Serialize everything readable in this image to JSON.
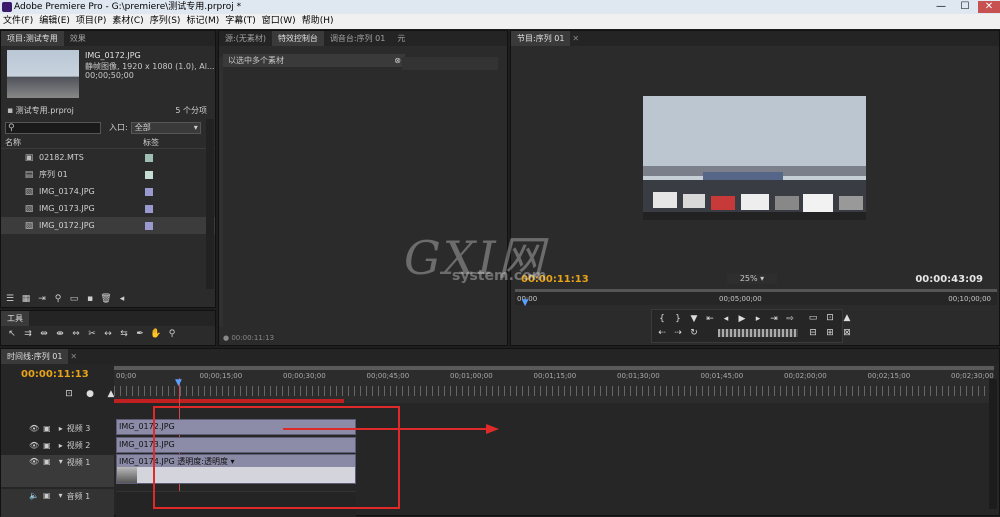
{
  "window": {
    "title": "Adobe Premiere Pro - G:\\premiere\\测试专用.prproj *",
    "minimize": "—",
    "maximize": "☐",
    "close": "✕"
  },
  "menu": [
    "文件(F)",
    "编辑(E)",
    "项目(P)",
    "素材(C)",
    "序列(S)",
    "标记(M)",
    "字幕(T)",
    "窗口(W)",
    "帮助(H)"
  ],
  "project": {
    "tabs": [
      "项目:测试专用",
      "效果"
    ],
    "preview": {
      "name": "IMG_0172.JPG",
      "info1": "静帧图像, 1920 x 1080 (1.0), Al...",
      "info2": "00;00;50;00"
    },
    "file": "测试专用.prproj",
    "count": "5 个分项",
    "entry_label": "入口:",
    "entry_value": "全部",
    "col_name": "名称",
    "col_label": "标签",
    "items": [
      {
        "name": "02182.MTS",
        "color": "#9fbeb4"
      },
      {
        "name": "序列 01",
        "color": "#c8dcd4"
      },
      {
        "name": "IMG_0174.JPG",
        "color": "#9a9ad0"
      },
      {
        "name": "IMG_0173.JPG",
        "color": "#9a9ad0"
      },
      {
        "name": "IMG_0172.JPG",
        "color": "#9a9ad0"
      }
    ]
  },
  "tools_tab": "工具",
  "effect_panel": {
    "tabs": [
      "源:(无素材)",
      "特效控制台",
      "调音台:序列 01",
      "元"
    ],
    "message": "以选中多个素材",
    "timecode": "00:00:11:13"
  },
  "program": {
    "tab": "节目:序列 01",
    "current_tc": "00:00:11:13",
    "zoom": "25%",
    "duration": "00:00:43:09",
    "ruler": [
      "00;00",
      "00;05;00;00",
      "00;10;00;00"
    ],
    "playhead_fraction": 0.018
  },
  "watermark": {
    "big": "GXI网",
    "small": "system.com"
  },
  "timeline": {
    "tab": "时间线:序列 01",
    "timecode": "00:00:11:13",
    "ruler": [
      "00;00",
      "00;00;15;00",
      "00;00;30;00",
      "00;00;45;00",
      "00;01;00;00",
      "00;01;15;00",
      "00;01;30;00",
      "00;01;45;00",
      "00;02;00;00",
      "00;02;15;00",
      "00;02;30;00"
    ],
    "tracks": [
      {
        "name": "视频 3",
        "clip": "IMG_0172.JPG"
      },
      {
        "name": "视频 2",
        "clip": "IMG_0173.JPG"
      },
      {
        "name": "视频 1",
        "clip": "IMG_0174.JPG  透明度:透明度 ▾"
      },
      {
        "name": "音频 1",
        "clip": ""
      }
    ]
  },
  "colors": {
    "accent": "#e8a317",
    "annotation": "#e02a2a",
    "clip": "#8c8ca8"
  }
}
